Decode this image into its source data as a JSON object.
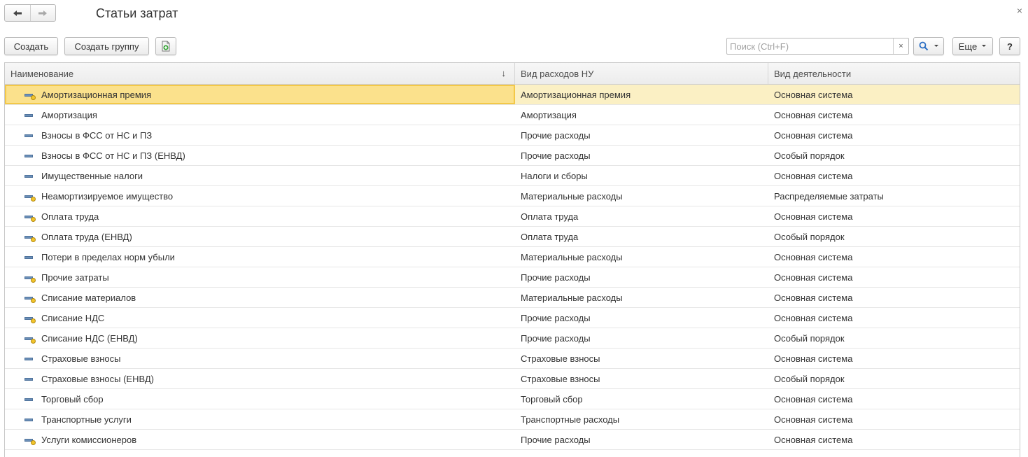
{
  "window": {
    "title": "Статьи затрат",
    "close_label": "×"
  },
  "nav": {
    "back_icon": "arrow-left-icon",
    "forward_icon": "arrow-right-icon"
  },
  "toolbar": {
    "create_label": "Создать",
    "create_group_label": "Создать группу",
    "copy_icon": "document-add-icon",
    "search_placeholder": "Поиск (Ctrl+F)",
    "search_value": "",
    "search_clear": "×",
    "search_icon": "magnifier-icon",
    "more_label": "Еще",
    "help_label": "?"
  },
  "table": {
    "columns": [
      "Наименование",
      "Вид расходов НУ",
      "Вид деятельности"
    ],
    "sort_indicator": "↓",
    "rows": [
      {
        "name": "Амортизационная премия",
        "expense_type": "Амортизационная премия",
        "activity": "Основная система",
        "predefined": true,
        "selected": true
      },
      {
        "name": "Амортизация",
        "expense_type": "Амортизация",
        "activity": "Основная система",
        "predefined": false
      },
      {
        "name": "Взносы в ФСС от НС и ПЗ",
        "expense_type": "Прочие расходы",
        "activity": "Основная система",
        "predefined": false
      },
      {
        "name": "Взносы в ФСС от НС и ПЗ (ЕНВД)",
        "expense_type": "Прочие расходы",
        "activity": "Особый порядок",
        "predefined": false
      },
      {
        "name": "Имущественные налоги",
        "expense_type": "Налоги и сборы",
        "activity": "Основная система",
        "predefined": false
      },
      {
        "name": "Неамортизируемое имущество",
        "expense_type": "Материальные расходы",
        "activity": "Распределяемые затраты",
        "predefined": true
      },
      {
        "name": "Оплата труда",
        "expense_type": "Оплата труда",
        "activity": "Основная система",
        "predefined": true
      },
      {
        "name": "Оплата труда (ЕНВД)",
        "expense_type": "Оплата труда",
        "activity": "Особый порядок",
        "predefined": true
      },
      {
        "name": "Потери в пределах норм убыли",
        "expense_type": "Материальные расходы",
        "activity": "Основная система",
        "predefined": false
      },
      {
        "name": "Прочие затраты",
        "expense_type": "Прочие расходы",
        "activity": "Основная система",
        "predefined": true
      },
      {
        "name": "Списание материалов",
        "expense_type": "Материальные расходы",
        "activity": "Основная система",
        "predefined": true
      },
      {
        "name": "Списание НДС",
        "expense_type": "Прочие расходы",
        "activity": "Основная система",
        "predefined": true
      },
      {
        "name": "Списание НДС (ЕНВД)",
        "expense_type": "Прочие расходы",
        "activity": "Особый порядок",
        "predefined": true
      },
      {
        "name": "Страховые взносы",
        "expense_type": "Страховые взносы",
        "activity": "Основная система",
        "predefined": false
      },
      {
        "name": "Страховые взносы (ЕНВД)",
        "expense_type": "Страховые взносы",
        "activity": "Особый порядок",
        "predefined": false
      },
      {
        "name": "Торговый сбор",
        "expense_type": "Торговый сбор",
        "activity": "Основная система",
        "predefined": false
      },
      {
        "name": "Транспортные услуги",
        "expense_type": "Транспортные расходы",
        "activity": "Основная система",
        "predefined": false
      },
      {
        "name": "Услуги комиссионеров",
        "expense_type": "Прочие расходы",
        "activity": "Основная система",
        "predefined": true
      }
    ]
  }
}
